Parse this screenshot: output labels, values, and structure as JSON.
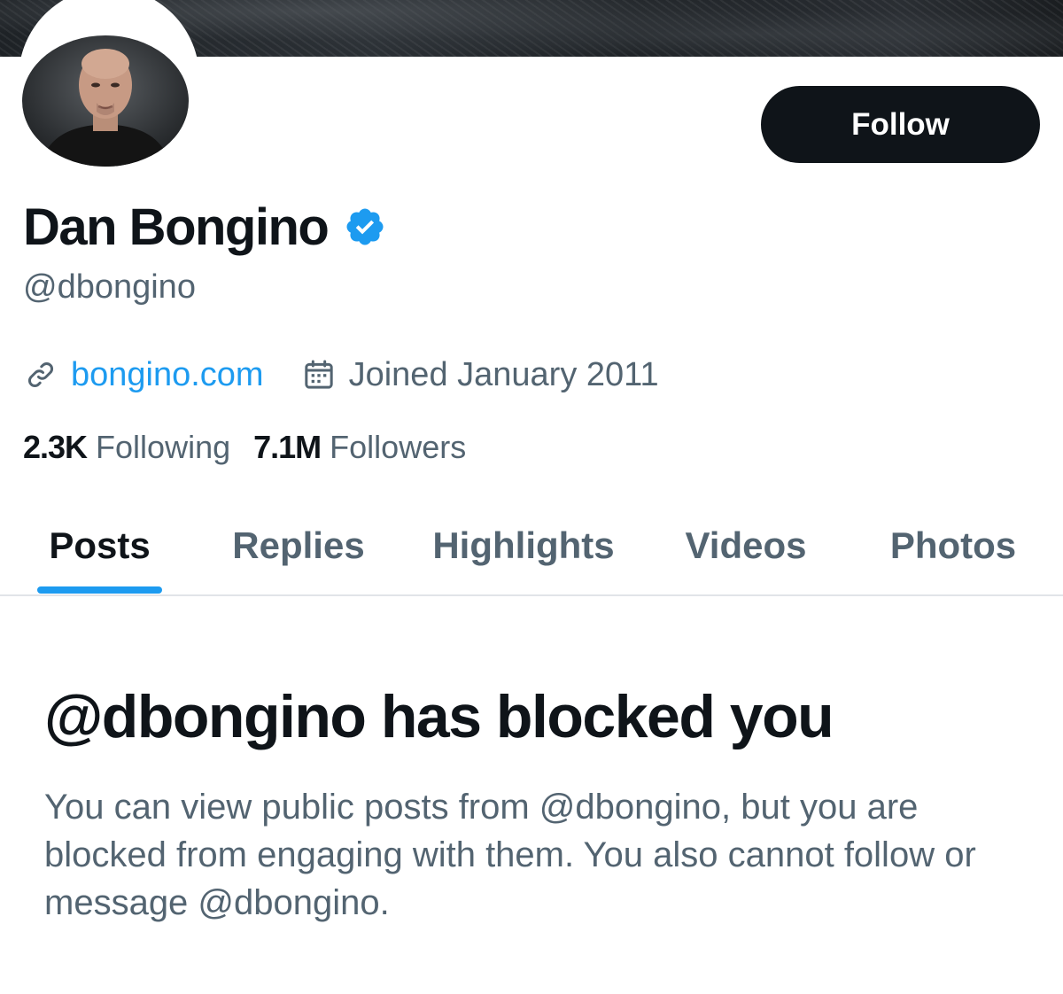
{
  "profile": {
    "display_name": "Dan Bongino",
    "handle": "@dbongino",
    "website": "bongino.com",
    "joined": "Joined January 2011",
    "following_count": "2.3K",
    "following_label": "Following",
    "followers_count": "7.1M",
    "followers_label": "Followers"
  },
  "actions": {
    "follow_label": "Follow"
  },
  "tabs": [
    {
      "label": "Posts",
      "active": true
    },
    {
      "label": "Replies",
      "active": false
    },
    {
      "label": "Highlights",
      "active": false
    },
    {
      "label": "Videos",
      "active": false
    },
    {
      "label": "Photos",
      "active": false
    }
  ],
  "blocked": {
    "title": "@dbongino has blocked you",
    "message": "You can view public posts from @dbongino, but you are blocked from engaging with them. You also cannot follow or message @dbongino."
  },
  "icons": {
    "verified": "verified-badge-icon",
    "link": "link-icon",
    "calendar": "calendar-icon"
  },
  "colors": {
    "accent": "#1d9bf0",
    "text_primary": "#0f1419",
    "text_secondary": "#536471",
    "button_bg": "#0f1419"
  }
}
